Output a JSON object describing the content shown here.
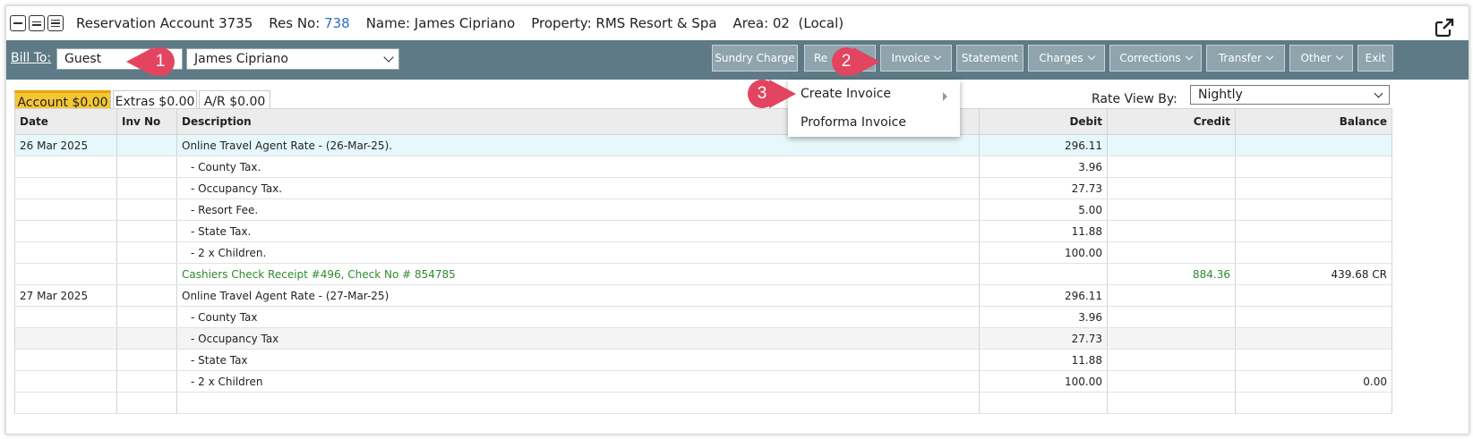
{
  "header": {
    "account": "Reservation Account 3735",
    "res_label": "Res No:",
    "res_no": "738",
    "name": "Name: James Cipriano",
    "property": "Property: RMS Resort & Spa",
    "area": "Area: 02",
    "local": "(Local)"
  },
  "toolbar": {
    "bill_to_label": "Bill To:",
    "bill_to_type": "Guest",
    "bill_to_name": "James Cipriano",
    "buttons": {
      "sundry": "Sundry Charge",
      "re": "Re",
      "invoice": "Invoice",
      "statement": "Statement",
      "charges": "Charges",
      "corrections": "Corrections",
      "transfer": "Transfer",
      "other": "Other",
      "exit": "Exit"
    }
  },
  "tabs": [
    {
      "label": "Account $0.00",
      "active": true
    },
    {
      "label": "Extras $0.00",
      "active": false
    },
    {
      "label": "A/R $0.00",
      "active": false
    }
  ],
  "rate_view": {
    "label": "Rate View By:",
    "value": "Nightly"
  },
  "invoice_menu": {
    "create": "Create Invoice",
    "proforma": "Proforma Invoice"
  },
  "markers": [
    "1",
    "2",
    "3"
  ],
  "table": {
    "headers": [
      "Date",
      "Inv No",
      "Description",
      "Debit",
      "Credit",
      "Balance"
    ],
    "rows": [
      {
        "date": "26 Mar 2025",
        "inv": "",
        "desc": "Online Travel Agent Rate - (26-Mar-25).",
        "debit": "296.11",
        "credit": "",
        "balance": ""
      },
      {
        "date": "",
        "inv": "",
        "desc": "- County Tax.",
        "debit": "3.96",
        "credit": "",
        "balance": ""
      },
      {
        "date": "",
        "inv": "",
        "desc": "- Occupancy Tax.",
        "debit": "27.73",
        "credit": "",
        "balance": ""
      },
      {
        "date": "",
        "inv": "",
        "desc": "- Resort Fee.",
        "debit": "5.00",
        "credit": "",
        "balance": ""
      },
      {
        "date": "",
        "inv": "",
        "desc": "- State Tax.",
        "debit": "11.88",
        "credit": "",
        "balance": ""
      },
      {
        "date": "",
        "inv": "",
        "desc": "- 2 x Children.",
        "debit": "100.00",
        "credit": "",
        "balance": ""
      },
      {
        "date": "",
        "inv": "",
        "desc": "Cashiers Check Receipt #496, Check No # 854785",
        "debit": "",
        "credit": "884.36",
        "balance": "439.68 CR"
      },
      {
        "date": "27 Mar 2025",
        "inv": "",
        "desc": "Online Travel Agent Rate - (27-Mar-25)",
        "debit": "296.11",
        "credit": "",
        "balance": ""
      },
      {
        "date": "",
        "inv": "",
        "desc": "- County Tax",
        "debit": "3.96",
        "credit": "",
        "balance": ""
      },
      {
        "date": "",
        "inv": "",
        "desc": "- Occupancy Tax",
        "debit": "27.73",
        "credit": "",
        "balance": ""
      },
      {
        "date": "",
        "inv": "",
        "desc": "- State Tax",
        "debit": "11.88",
        "credit": "",
        "balance": ""
      },
      {
        "date": "",
        "inv": "",
        "desc": "- 2 x Children",
        "debit": "100.00",
        "credit": "",
        "balance": "0.00"
      },
      {
        "date": "",
        "inv": "",
        "desc": "",
        "debit": "",
        "credit": "",
        "balance": ""
      }
    ]
  },
  "colors": {
    "toolbar": "#5e7a86",
    "button": "#8fa4ad",
    "active_tab": "#f5c634",
    "highlight_row": "#e6f8fb",
    "receipt_text": "#2e8a2e",
    "marker": "#e3445f",
    "link": "#2f6fc0"
  }
}
